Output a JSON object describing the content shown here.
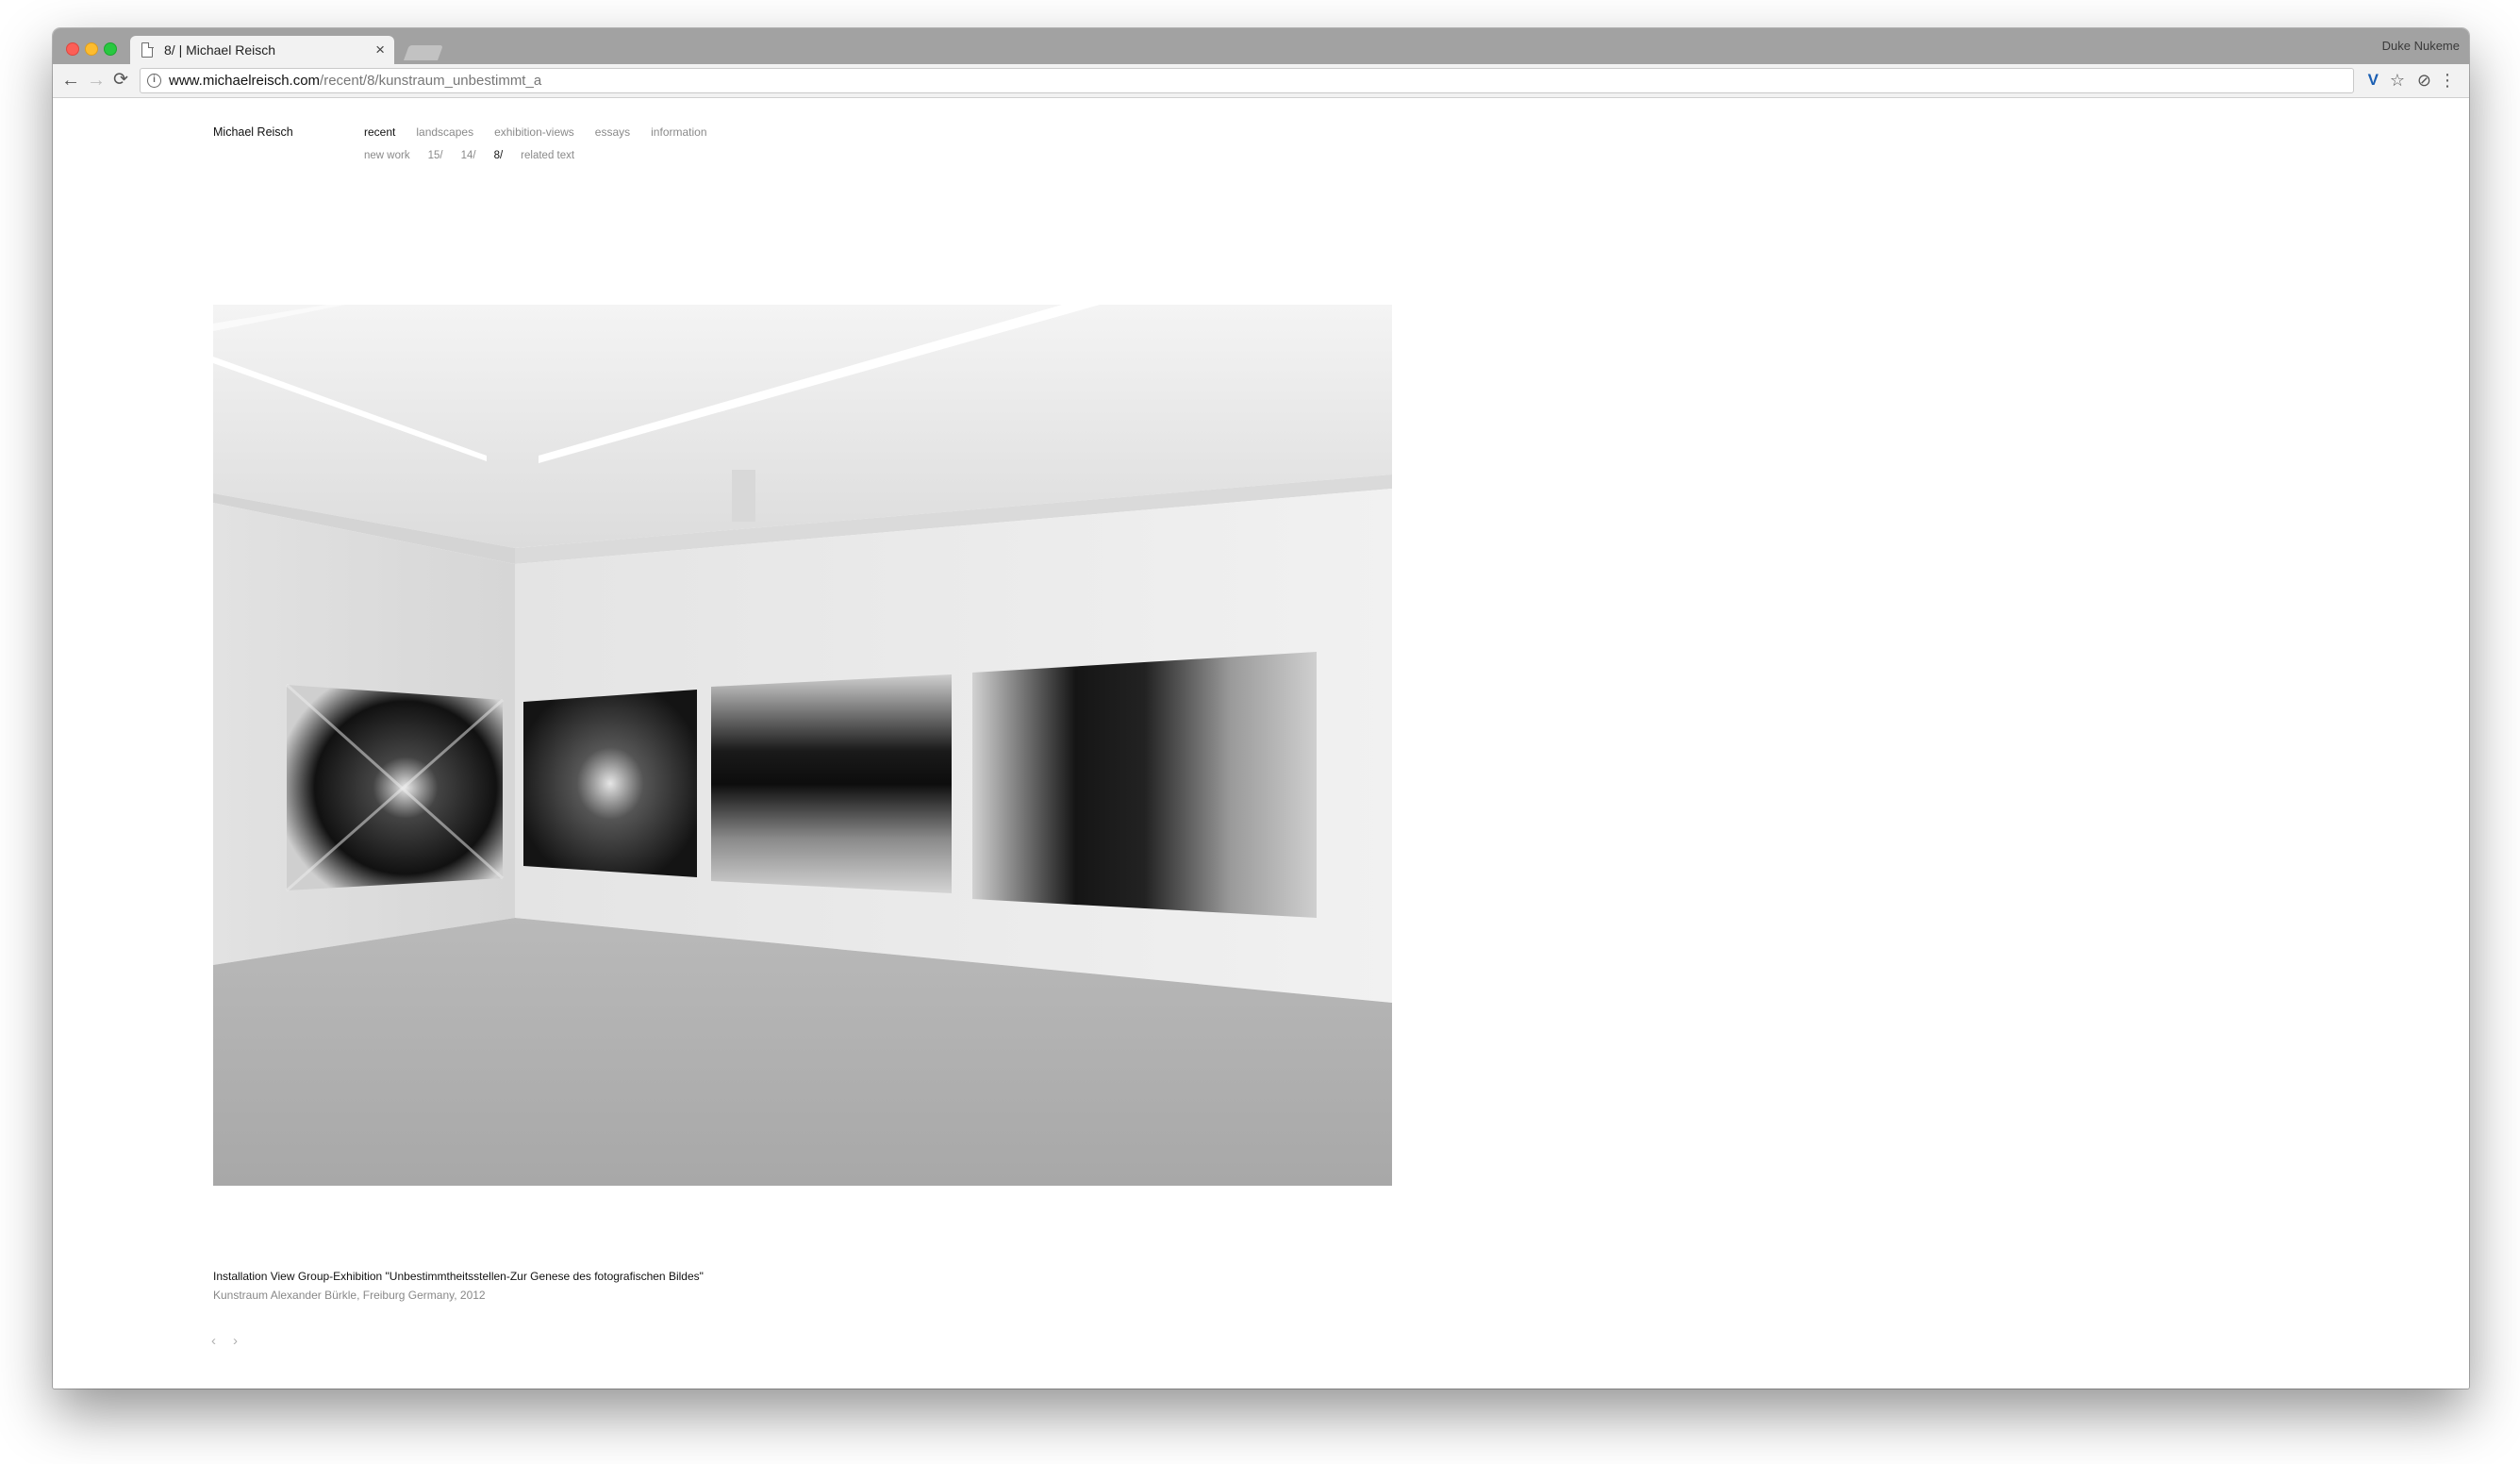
{
  "browser": {
    "tab_title": "8/ | Michael Reisch",
    "tab_close": "×",
    "profile_name": "Duke Nukeme",
    "url_host": "www.michaelreisch.com",
    "url_path": "/recent/8/kunstraum_unbestimmt_a",
    "icons": {
      "back": "←",
      "forward": "→",
      "reload": "⟳",
      "info": "i",
      "extension_v": "V",
      "star": "☆",
      "extension2": "⊘",
      "menu": "⋮"
    }
  },
  "site": {
    "name": "Michael Reisch",
    "nav": [
      {
        "label": "recent",
        "active": true
      },
      {
        "label": "landscapes",
        "active": false
      },
      {
        "label": "exhibition-views",
        "active": false
      },
      {
        "label": "essays",
        "active": false
      },
      {
        "label": "information",
        "active": false
      }
    ],
    "subnav": [
      {
        "label": "new work",
        "active": false
      },
      {
        "label": "15/",
        "active": false
      },
      {
        "label": "14/",
        "active": false
      },
      {
        "label": "8/",
        "active": true
      },
      {
        "label": "related text",
        "active": false
      }
    ]
  },
  "caption": {
    "title": "Installation View Group-Exhibition \"Unbestimmtheitsstellen-Zur Genese des fotografischen Bildes\"",
    "subtitle": "Kunstraum Alexander Bürkle, Freiburg Germany, 2012"
  },
  "pager": {
    "prev": "‹",
    "next": "›"
  }
}
